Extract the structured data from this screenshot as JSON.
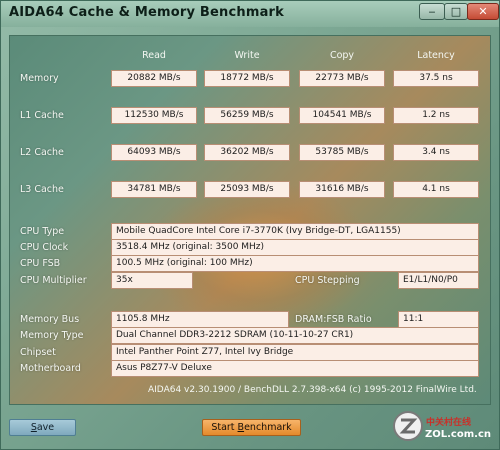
{
  "window": {
    "title": "AIDA64 Cache & Memory Benchmark"
  },
  "titlebar_buttons": {
    "minimize": "‒",
    "maximize": "□",
    "close": "✕"
  },
  "columns": [
    "Read",
    "Write",
    "Copy",
    "Latency"
  ],
  "benchmarks": [
    {
      "label": "Memory",
      "read": "20882 MB/s",
      "write": "18772 MB/s",
      "copy": "22773 MB/s",
      "latency": "37.5 ns"
    },
    {
      "label": "L1 Cache",
      "read": "112530 MB/s",
      "write": "56259 MB/s",
      "copy": "104541 MB/s",
      "latency": "1.2 ns"
    },
    {
      "label": "L2 Cache",
      "read": "64093 MB/s",
      "write": "36202 MB/s",
      "copy": "53785 MB/s",
      "latency": "3.4 ns"
    },
    {
      "label": "L3 Cache",
      "read": "34781 MB/s",
      "write": "25093 MB/s",
      "copy": "31616 MB/s",
      "latency": "4.1 ns"
    }
  ],
  "cpu": {
    "type": {
      "label": "CPU Type",
      "value": "Mobile QuadCore Intel Core i7-3770K  (Ivy Bridge-DT, LGA1155)"
    },
    "clock": {
      "label": "CPU Clock",
      "value": "3518.4 MHz  (original: 3500 MHz)"
    },
    "fsb": {
      "label": "CPU FSB",
      "value": "100.5 MHz  (original: 100 MHz)"
    },
    "multiplier": {
      "label": "CPU Multiplier",
      "value": "35x"
    },
    "stepping": {
      "label": "CPU Stepping",
      "value": "E1/L1/N0/P0"
    }
  },
  "memory": {
    "bus": {
      "label": "Memory Bus",
      "value": "1105.8 MHz"
    },
    "ratio": {
      "label": "DRAM:FSB Ratio",
      "value": "11:1"
    },
    "type": {
      "label": "Memory Type",
      "value": "Dual Channel DDR3-2212 SDRAM  (10-11-10-27 CR1)"
    },
    "chipset": {
      "label": "Chipset",
      "value": "Intel Panther Point Z77, Intel Ivy Bridge"
    },
    "motherboard": {
      "label": "Motherboard",
      "value": "Asus P8Z77-V Deluxe"
    }
  },
  "footer": {
    "version": "AIDA64 v2.30.1900 / BenchDLL 2.7.398-x64  (c) 1995-2012 FinalWire Ltd."
  },
  "buttons": {
    "save_label_first": "S",
    "save_label_rest": "ave",
    "start_label": "Start ",
    "start_label_ul": "B",
    "start_label_rest": "enchmark"
  },
  "watermark": {
    "cn": "中关村在线",
    "url": "ZOL.com.cn"
  }
}
